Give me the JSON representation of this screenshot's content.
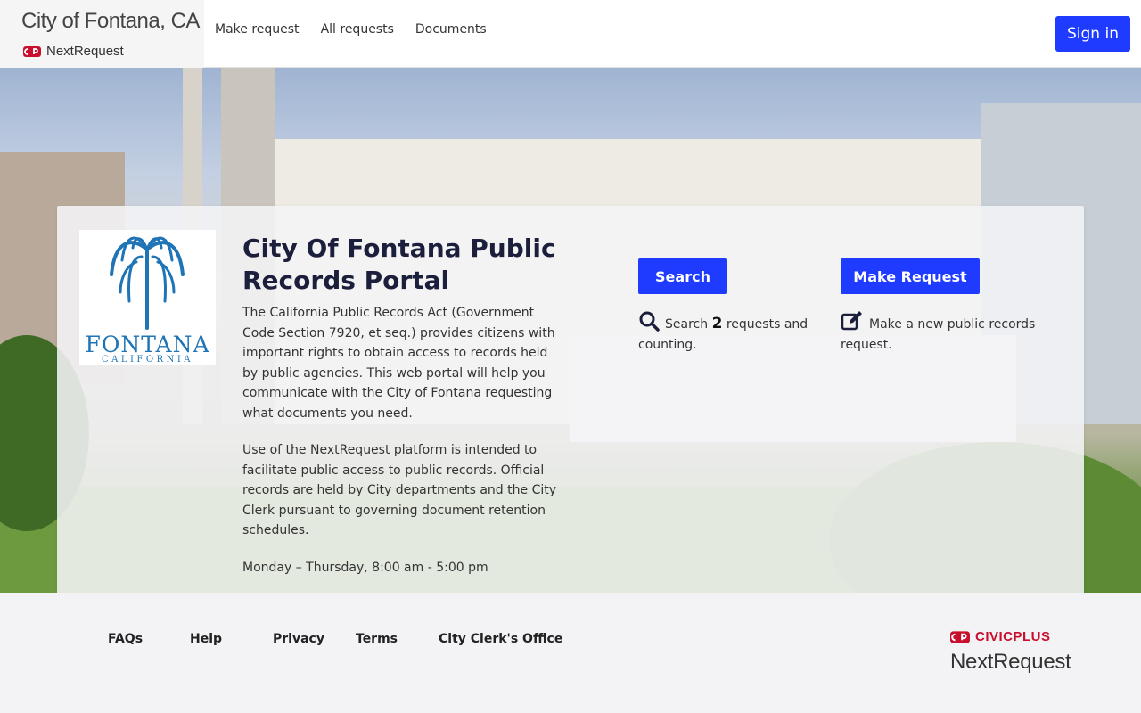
{
  "header": {
    "brand_title": "City of Fontana, CA",
    "brand_sub": "NextRequest",
    "nav": [
      "Make request",
      "All requests",
      "Documents"
    ],
    "sign_in": "Sign in"
  },
  "card": {
    "logo_word": "FONTANA",
    "logo_sub": "CALIFORNIA",
    "title": "City Of Fontana Public Records Portal",
    "paragraphs": [
      "The California Public Records Act (Government Code Section 7920, et seq.) provides citizens with important rights to obtain access to records held by public agencies. This web portal will help you communicate with the City of Fontana requesting what documents you need.",
      "Use of the NextRequest platform is intended to facilitate public access to public records. Official records are held by City departments and the City Clerk pursuant to governing document retention schedules.",
      "Monday – Thursday, 8:00 am - 5:00 pm"
    ],
    "search_button": "Search",
    "search_desc_pre": "Search ",
    "search_count": "2",
    "search_desc_post": " requests and counting.",
    "make_button": "Make Request",
    "make_desc": "Make a new public records request.",
    "icons": {
      "search": "magnifier-icon",
      "make": "edit-icon"
    }
  },
  "footer": {
    "links": [
      "FAQs",
      "Help",
      "Privacy",
      "Terms",
      "City Clerk's Office"
    ],
    "civic": "CIVICPLUS",
    "nextrequest": "NextRequest"
  },
  "colors": {
    "accent": "#1e3bff",
    "logo_blue": "#1f74b6",
    "civic_red": "#c8102e"
  }
}
